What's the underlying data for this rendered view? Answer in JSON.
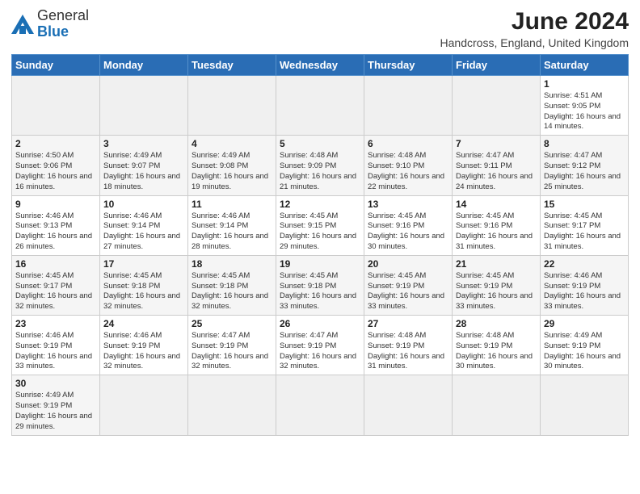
{
  "header": {
    "logo_general": "General",
    "logo_blue": "Blue",
    "month_title": "June 2024",
    "location": "Handcross, England, United Kingdom"
  },
  "days_of_week": [
    "Sunday",
    "Monday",
    "Tuesday",
    "Wednesday",
    "Thursday",
    "Friday",
    "Saturday"
  ],
  "weeks": [
    [
      null,
      null,
      null,
      null,
      null,
      null,
      {
        "day": "1",
        "sunrise": "4:51 AM",
        "sunset": "9:05 PM",
        "daylight": "16 hours and 14 minutes."
      }
    ],
    [
      {
        "day": "2",
        "sunrise": "4:50 AM",
        "sunset": "9:06 PM",
        "daylight": "16 hours and 16 minutes."
      },
      {
        "day": "3",
        "sunrise": "4:49 AM",
        "sunset": "9:07 PM",
        "daylight": "16 hours and 18 minutes."
      },
      {
        "day": "4",
        "sunrise": "4:49 AM",
        "sunset": "9:08 PM",
        "daylight": "16 hours and 19 minutes."
      },
      {
        "day": "5",
        "sunrise": "4:48 AM",
        "sunset": "9:09 PM",
        "daylight": "16 hours and 21 minutes."
      },
      {
        "day": "6",
        "sunrise": "4:48 AM",
        "sunset": "9:10 PM",
        "daylight": "16 hours and 22 minutes."
      },
      {
        "day": "7",
        "sunrise": "4:47 AM",
        "sunset": "9:11 PM",
        "daylight": "16 hours and 24 minutes."
      },
      {
        "day": "8",
        "sunrise": "4:47 AM",
        "sunset": "9:12 PM",
        "daylight": "16 hours and 25 minutes."
      }
    ],
    [
      {
        "day": "9",
        "sunrise": "4:46 AM",
        "sunset": "9:13 PM",
        "daylight": "16 hours and 26 minutes."
      },
      {
        "day": "10",
        "sunrise": "4:46 AM",
        "sunset": "9:14 PM",
        "daylight": "16 hours and 27 minutes."
      },
      {
        "day": "11",
        "sunrise": "4:46 AM",
        "sunset": "9:14 PM",
        "daylight": "16 hours and 28 minutes."
      },
      {
        "day": "12",
        "sunrise": "4:45 AM",
        "sunset": "9:15 PM",
        "daylight": "16 hours and 29 minutes."
      },
      {
        "day": "13",
        "sunrise": "4:45 AM",
        "sunset": "9:16 PM",
        "daylight": "16 hours and 30 minutes."
      },
      {
        "day": "14",
        "sunrise": "4:45 AM",
        "sunset": "9:16 PM",
        "daylight": "16 hours and 31 minutes."
      },
      {
        "day": "15",
        "sunrise": "4:45 AM",
        "sunset": "9:17 PM",
        "daylight": "16 hours and 31 minutes."
      }
    ],
    [
      {
        "day": "16",
        "sunrise": "4:45 AM",
        "sunset": "9:17 PM",
        "daylight": "16 hours and 32 minutes."
      },
      {
        "day": "17",
        "sunrise": "4:45 AM",
        "sunset": "9:18 PM",
        "daylight": "16 hours and 32 minutes."
      },
      {
        "day": "18",
        "sunrise": "4:45 AM",
        "sunset": "9:18 PM",
        "daylight": "16 hours and 32 minutes."
      },
      {
        "day": "19",
        "sunrise": "4:45 AM",
        "sunset": "9:18 PM",
        "daylight": "16 hours and 33 minutes."
      },
      {
        "day": "20",
        "sunrise": "4:45 AM",
        "sunset": "9:19 PM",
        "daylight": "16 hours and 33 minutes."
      },
      {
        "day": "21",
        "sunrise": "4:45 AM",
        "sunset": "9:19 PM",
        "daylight": "16 hours and 33 minutes."
      },
      {
        "day": "22",
        "sunrise": "4:46 AM",
        "sunset": "9:19 PM",
        "daylight": "16 hours and 33 minutes."
      }
    ],
    [
      {
        "day": "23",
        "sunrise": "4:46 AM",
        "sunset": "9:19 PM",
        "daylight": "16 hours and 33 minutes."
      },
      {
        "day": "24",
        "sunrise": "4:46 AM",
        "sunset": "9:19 PM",
        "daylight": "16 hours and 32 minutes."
      },
      {
        "day": "25",
        "sunrise": "4:47 AM",
        "sunset": "9:19 PM",
        "daylight": "16 hours and 32 minutes."
      },
      {
        "day": "26",
        "sunrise": "4:47 AM",
        "sunset": "9:19 PM",
        "daylight": "16 hours and 32 minutes."
      },
      {
        "day": "27",
        "sunrise": "4:48 AM",
        "sunset": "9:19 PM",
        "daylight": "16 hours and 31 minutes."
      },
      {
        "day": "28",
        "sunrise": "4:48 AM",
        "sunset": "9:19 PM",
        "daylight": "16 hours and 30 minutes."
      },
      {
        "day": "29",
        "sunrise": "4:49 AM",
        "sunset": "9:19 PM",
        "daylight": "16 hours and 30 minutes."
      }
    ],
    [
      {
        "day": "30",
        "sunrise": "4:49 AM",
        "sunset": "9:19 PM",
        "daylight": "16 hours and 29 minutes."
      },
      null,
      null,
      null,
      null,
      null,
      null
    ]
  ]
}
